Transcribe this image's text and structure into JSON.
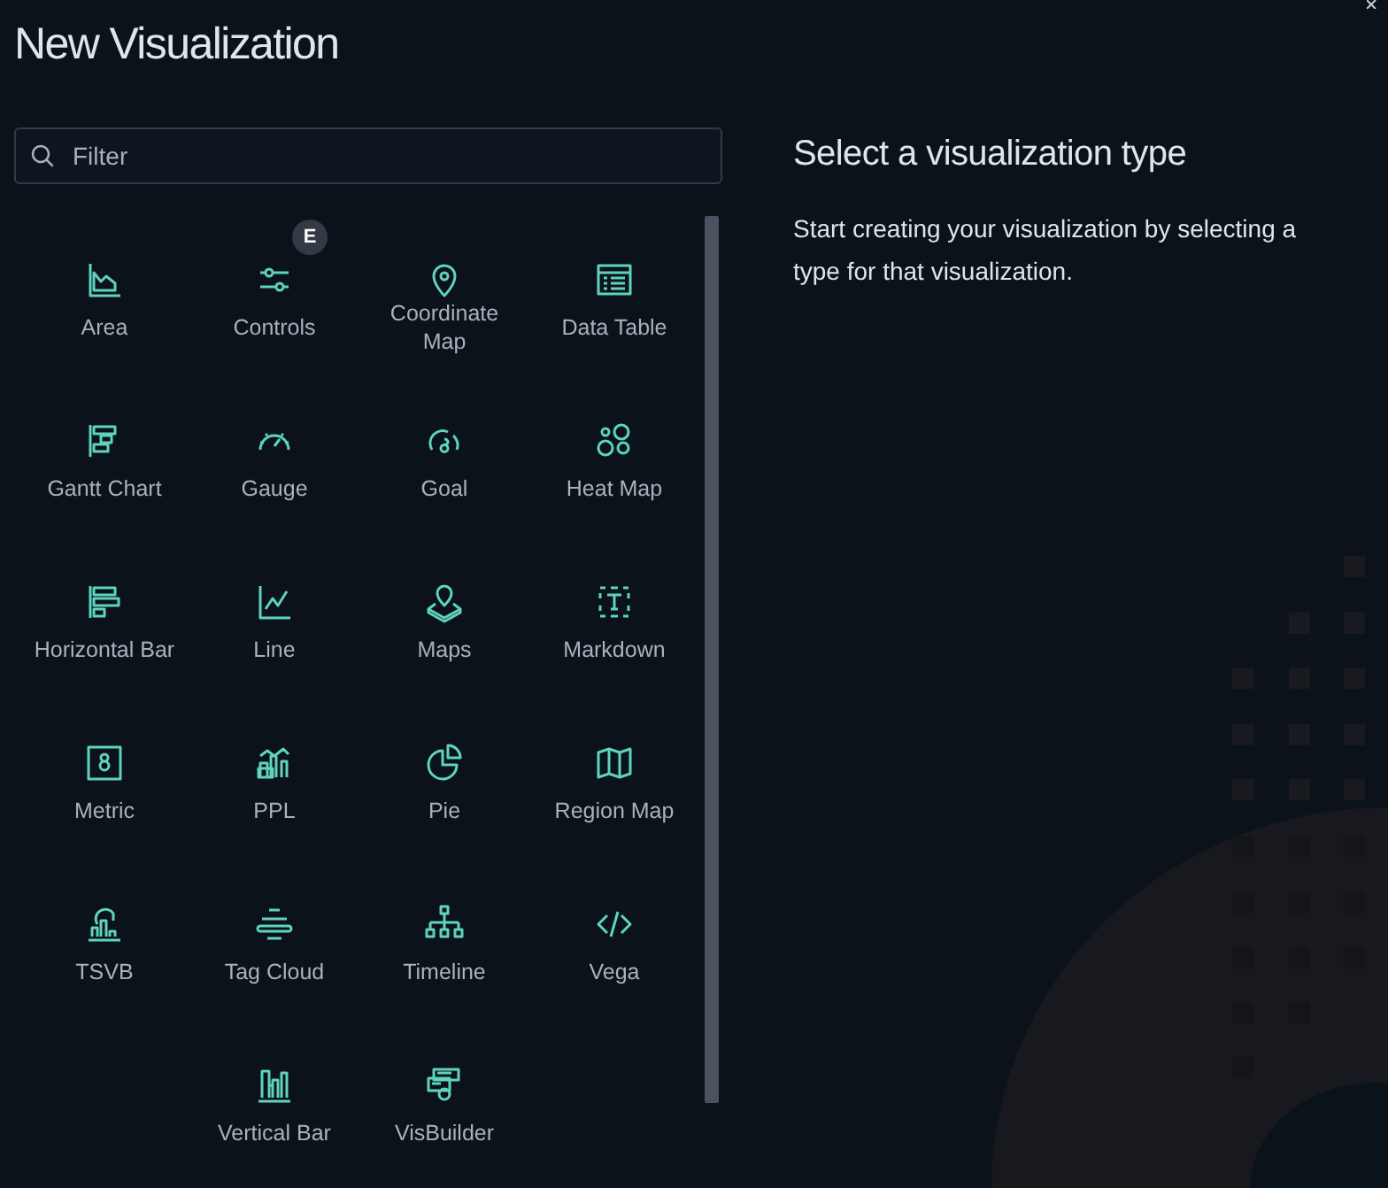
{
  "title": "New Visualization",
  "filter": {
    "placeholder": "Filter"
  },
  "types": [
    {
      "label": "Area"
    },
    {
      "label": "Controls",
      "badge": "E"
    },
    {
      "label": "Coordinate Map"
    },
    {
      "label": "Data Table"
    },
    {
      "label": "Gantt Chart"
    },
    {
      "label": "Gauge"
    },
    {
      "label": "Goal"
    },
    {
      "label": "Heat Map"
    },
    {
      "label": "Horizontal Bar"
    },
    {
      "label": "Line"
    },
    {
      "label": "Maps"
    },
    {
      "label": "Markdown"
    },
    {
      "label": "Metric"
    },
    {
      "label": "PPL"
    },
    {
      "label": "Pie"
    },
    {
      "label": "Region Map"
    },
    {
      "label": "TSVB"
    },
    {
      "label": "Tag Cloud"
    },
    {
      "label": "Timeline"
    },
    {
      "label": "Vega"
    },
    {
      "label": "Vertical Bar"
    },
    {
      "label": "VisBuilder"
    }
  ],
  "info": {
    "heading": "Select a visualization type",
    "text": "Start creating your visualization by selecting a type for that visualization."
  }
}
